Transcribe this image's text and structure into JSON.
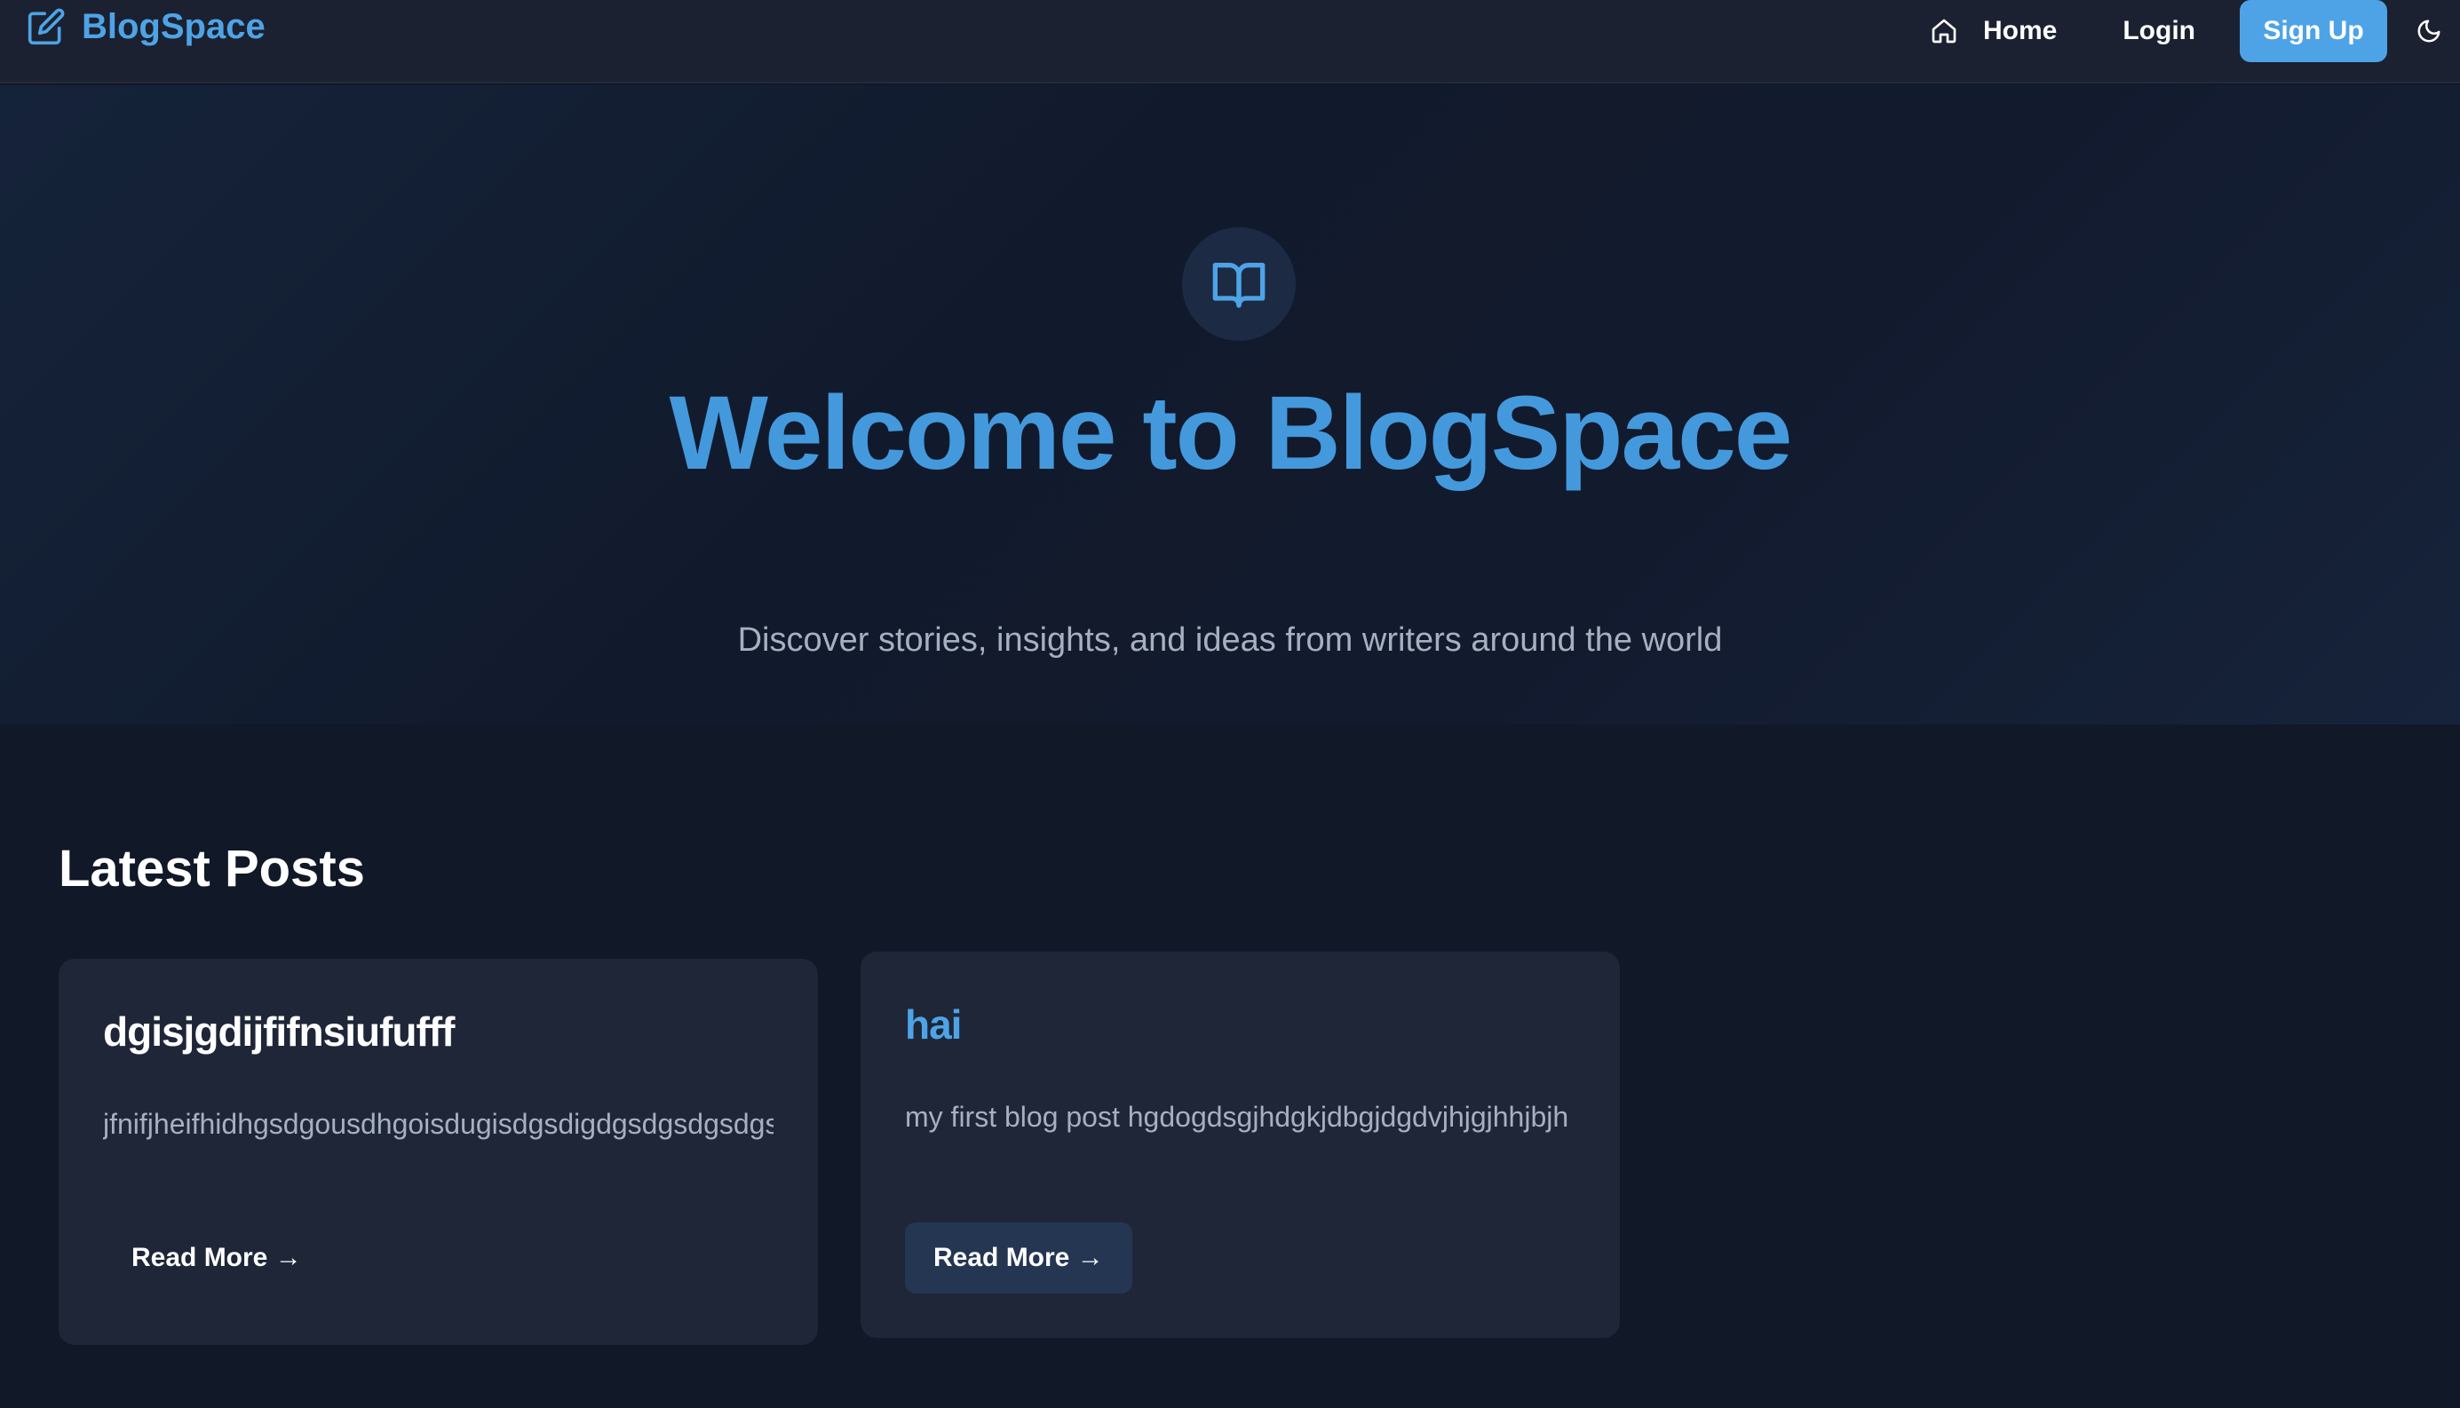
{
  "navbar": {
    "brand": "BlogSpace",
    "home_label": "Home",
    "login_label": "Login",
    "signup_label": "Sign Up",
    "icons": {
      "brand": "edit-square-icon",
      "home": "home-icon",
      "theme": "moon-icon"
    }
  },
  "hero": {
    "icon": "open-book-icon",
    "title": "Welcome to BlogSpace",
    "subtitle": "Discover stories, insights, and ideas from writers around the world"
  },
  "latest": {
    "heading": "Latest Posts",
    "posts": [
      {
        "title": "dgisjgdijfifnsiufufff",
        "excerpt": "jfnifjheifhidhgsdgousdhgoisdugisdgsdigdgsdgsdgsdgsdgsd",
        "read_more": "Read More →"
      },
      {
        "title": "hai",
        "excerpt": "my first blog post hgdogdsgjhdgkjdbgjdgdvjhjgjhhjbjh",
        "read_more": "Read More →"
      }
    ]
  },
  "colors": {
    "accent": "#4ea3e6",
    "background": "#111827",
    "navbar": "#1b2130",
    "card": "#1e2638"
  }
}
